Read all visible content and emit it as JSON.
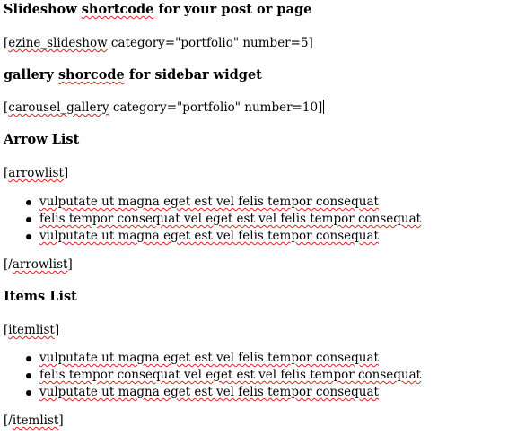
{
  "slideshow_heading": {
    "part1": "Slideshow ",
    "part2": "shortcode",
    "part3": " for your post or page"
  },
  "slideshow_code": {
    "part1": "[",
    "part2": "ezine_slideshow",
    "part3": " category=\"portfolio\" number=5]"
  },
  "gallery_heading": {
    "part1": "gallery ",
    "part2": "shorcode",
    "part3": " for sidebar widget"
  },
  "carousel_code": {
    "part1": "[",
    "part2": "carousel_gallery",
    "part3": " category=\"portfolio\" number=10]"
  },
  "arrow_list": {
    "heading": "Arrow List",
    "open_tag": {
      "part1": "[",
      "part2": "arrowlist",
      "part3": "]"
    },
    "items": [
      "vulputate ut magna eget est vel felis tempor consequat",
      "felis tempor consequat vel eget est vel felis tempor consequat",
      "vulputate ut magna eget est vel felis tempor consequat"
    ],
    "close_tag": {
      "part1": "[/",
      "part2": "arrowlist",
      "part3": "]"
    }
  },
  "items_list": {
    "heading": "Items List",
    "open_tag": {
      "part1": "[",
      "part2": "itemlist",
      "part3": "]"
    },
    "items": [
      "vulputate ut magna eget est vel felis tempor consequat",
      "felis tempor consequat vel eget est vel felis tempor consequat",
      "vulputate ut magna eget est vel felis tempor consequat"
    ],
    "close_tag": {
      "part1": "[/",
      "part2": "itemlist",
      "part3": "]"
    }
  }
}
